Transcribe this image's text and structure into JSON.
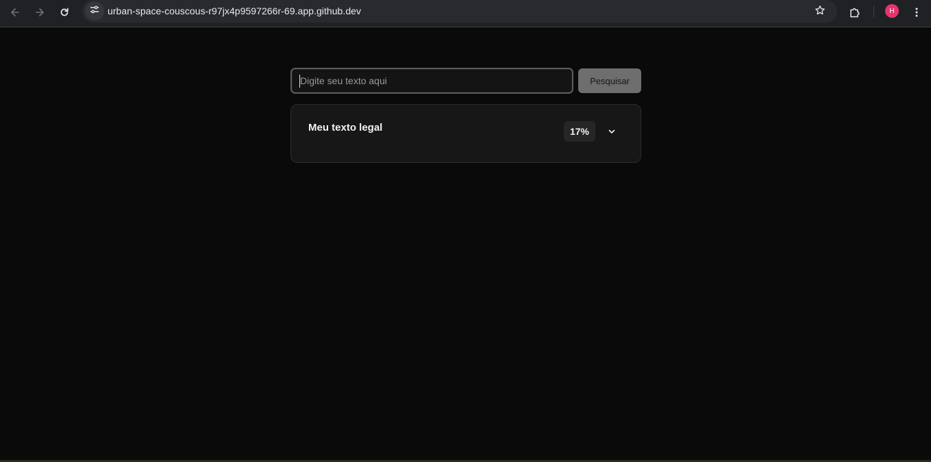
{
  "browser": {
    "url": "urban-space-couscous-r97jx4p9597266r-69.app.github.dev",
    "profile_initial": "H",
    "icons": {
      "back": "arrow-left-icon",
      "forward": "arrow-right-icon",
      "reload": "reload-icon",
      "site_info": "tune-icon",
      "bookmark": "star-icon",
      "extensions": "puzzle-icon",
      "menu": "kebab-menu-icon"
    },
    "colors": {
      "toolbar": "#202124",
      "avatar": "#e8336f"
    }
  },
  "search": {
    "placeholder": "Digite seu texto aqui",
    "value": "",
    "button_label": "Pesquisar"
  },
  "result": {
    "title": "Meu texto legal",
    "percent": "17%",
    "expand_icon": "chevron-down-icon"
  },
  "colors": {
    "background": "#0a0a0a",
    "card": "#171717",
    "button": "#6e6e6e"
  }
}
